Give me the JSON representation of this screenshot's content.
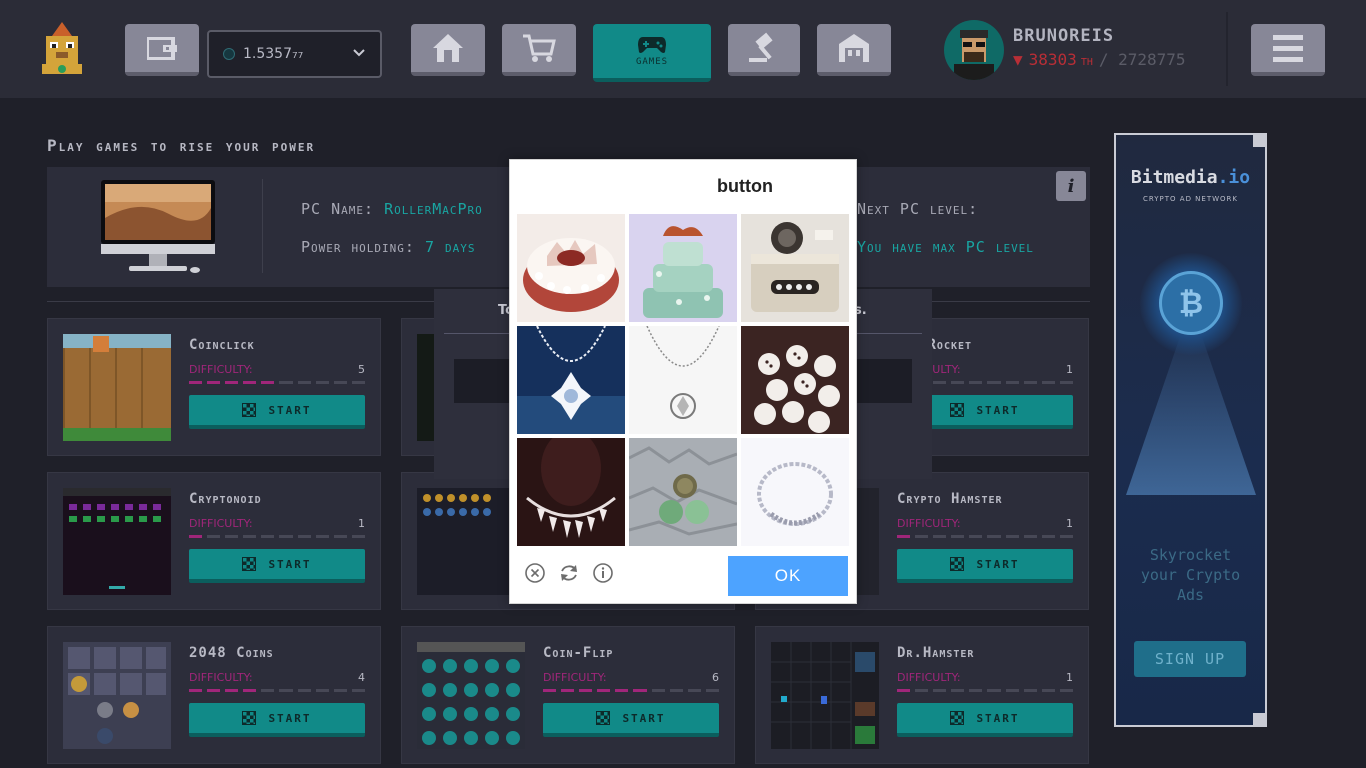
{
  "topbar": {
    "balance": "1.5357₇₇",
    "games_label": "GAMES",
    "username": "BRUNOREIS",
    "power_current": "38303",
    "power_unit": "TH",
    "power_total": "/ 2728775"
  },
  "main": {
    "heading": "Play games to rise your power",
    "pc": {
      "name_label": "PC Name:",
      "name_value": "RollerMacPro",
      "holding_label": "Power holding:",
      "holding_value": "7 days",
      "next_label": "Next PC level:",
      "next_value": "You have max PC level"
    },
    "difficulty_label": "DIFFICULTY:",
    "start_label": "START",
    "games": [
      {
        "title": "Coinclick",
        "difficulty": "5"
      },
      {
        "title": "",
        "difficulty": ""
      },
      {
        "title": "ppy Rocket",
        "difficulty": "1"
      },
      {
        "title": "Cryptonoid",
        "difficulty": "1"
      },
      {
        "title": "",
        "difficulty": ""
      },
      {
        "title": "Crypto Hamster",
        "difficulty": "1"
      },
      {
        "title": "2048 Coins",
        "difficulty": "4"
      },
      {
        "title": "Coin-Flip",
        "difficulty": "6"
      },
      {
        "title": "Dr.Hamster",
        "difficulty": "1"
      }
    ]
  },
  "bg_modal": {
    "left_text": "To",
    "right_text": "s."
  },
  "captcha": {
    "title": "button",
    "ok_label": "OK",
    "tiles": [
      "cake",
      "cake-green",
      "camera",
      "necklace-blue",
      "necklace-white",
      "buttons",
      "necklace-red",
      "coins",
      "necklace-silver"
    ]
  },
  "ad": {
    "brand": "Bitmedia",
    "brand_tld": ".io",
    "subtitle": "CRYPTO AD NETWORK",
    "tagline_1": "Skyrocket",
    "tagline_2": "your Crypto",
    "tagline_3": "Ads",
    "signup_label": "SIGN UP"
  },
  "colors": {
    "accent": "#118a88",
    "difficulty": "#a0267a",
    "ok": "#4da3ff",
    "background": "#1f2029"
  },
  "icons": [
    "logo-icon",
    "wallet-icon",
    "home-icon",
    "cart-icon",
    "gamepad-icon",
    "auction-icon",
    "factory-icon",
    "menu-icon",
    "info-icon",
    "close-icon",
    "refresh-icon",
    "info-circle-icon"
  ]
}
